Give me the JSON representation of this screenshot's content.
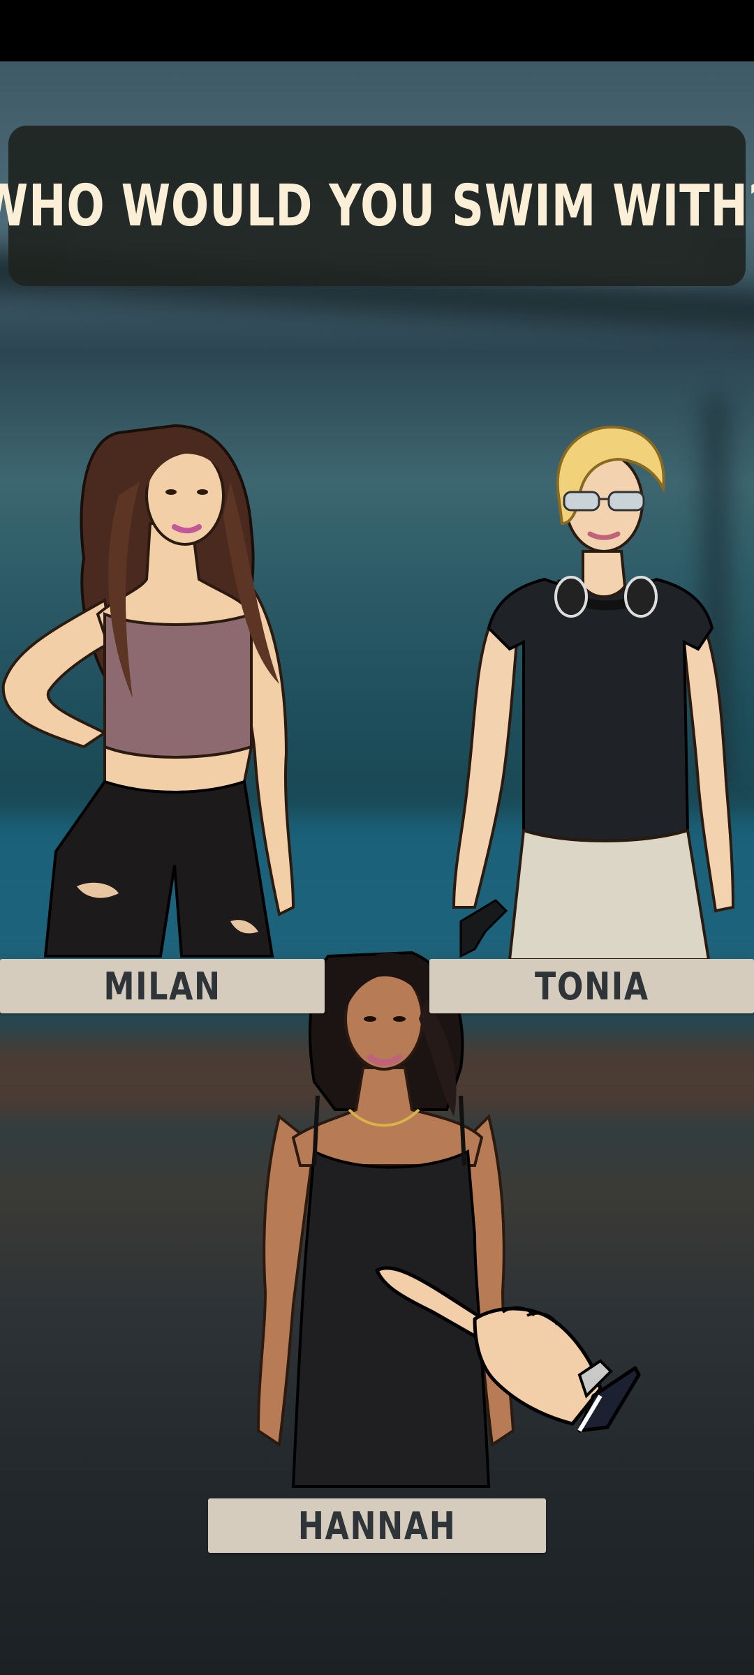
{
  "screen": {
    "title": "WHO WOULD YOU SWIM WITH?"
  },
  "characters": [
    {
      "id": "milan",
      "name": "MILAN"
    },
    {
      "id": "tonia",
      "name": "TONIA"
    },
    {
      "id": "hannah",
      "name": "HANNAH"
    }
  ],
  "tutorial": {
    "pointer_icon": "pointing-hand-icon"
  },
  "colors": {
    "title_text": "#fbefd7",
    "title_panel": "#1e2420",
    "name_plate": "#d5ccbd",
    "name_text": "#2e3438"
  }
}
